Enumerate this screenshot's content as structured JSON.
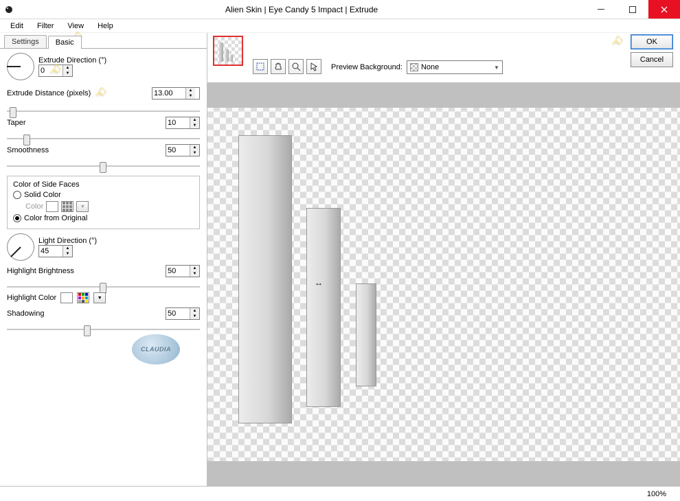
{
  "window": {
    "title": "Alien Skin | Eye Candy 5 Impact | Extrude"
  },
  "menubar": {
    "items": [
      "Edit",
      "Filter",
      "View",
      "Help"
    ]
  },
  "tabs": {
    "settings": "Settings",
    "basic": "Basic"
  },
  "controls": {
    "extrude_direction_label": "Extrude Direction (°)",
    "extrude_direction_value": "0",
    "extrude_distance_label": "Extrude Distance (pixels)",
    "extrude_distance_value": "13.00",
    "taper_label": "Taper",
    "taper_value": "10",
    "smoothness_label": "Smoothness",
    "smoothness_value": "50",
    "color_group_label": "Color of Side Faces",
    "solid_color_label": "Solid Color",
    "color_sublabel": "Color",
    "color_from_original_label": "Color from Original",
    "light_direction_label": "Light Direction (°)",
    "light_direction_value": "45",
    "highlight_brightness_label": "Highlight Brightness",
    "highlight_brightness_value": "50",
    "highlight_color_label": "Highlight Color",
    "shadowing_label": "Shadowing",
    "shadowing_value": "50"
  },
  "preview": {
    "preview_bg_label": "Preview Background:",
    "preview_bg_value": "None"
  },
  "buttons": {
    "ok": "OK",
    "cancel": "Cancel"
  },
  "status": {
    "zoom": "100%"
  },
  "watermark": "CLAUDIA"
}
